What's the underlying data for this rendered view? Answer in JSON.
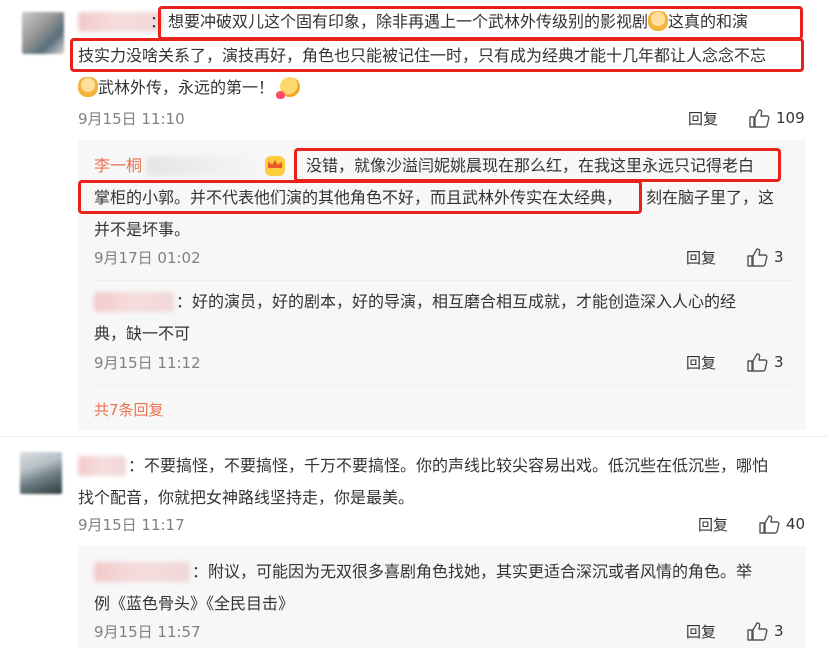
{
  "comments": [
    {
      "name_visible": "",
      "name_suffix": "：",
      "lines": [
        "想要冲破双儿这个固有印象，除非再遇上一个武林外传级别的影视剧",
        "这真的和演",
        "技实力没啥关系了，演技再好，角色也只能被记住一时，只有成为经典才能十几年都让人念念不忘",
        "武林外传，永远的第一！"
      ],
      "time": "9月15日 11:10",
      "reply_label": "回复",
      "like_count": "109"
    },
    {
      "name_visible": "",
      "name_suffix": "：",
      "lines": [
        "不要搞怪，不要搞怪，千万不要搞怪。你的声线比较尖容易出戏。低沉些在低沉些，哪怕",
        "找个配音，你就把女神路线坚持走，你是最美。"
      ],
      "time": "9月15日 11:17",
      "reply_label": "回复",
      "like_count": "40"
    }
  ],
  "replies": [
    {
      "name_visible": "李一桐",
      "lines": [
        "没错，就像沙溢闫妮姚晨现在那么红，在我这里永远只记得老白",
        "掌柜的小郭。并不代表他们演的其他角色不好，而且武林外传实在太经典，",
        "刻在脑子里了，这",
        "并不是坏事。"
      ],
      "time": "9月17日 01:02",
      "reply_label": "回复",
      "like_count": "3"
    },
    {
      "name_visible": "",
      "name_suffix": "：",
      "lines": [
        "好的演员，好的剧本，好的导演，相互磨合相互成就，才能创造深入人心的经",
        "典，缺一不可"
      ],
      "time": "9月15日 11:12",
      "reply_label": "回复",
      "like_count": "3"
    },
    {
      "name_visible": "",
      "name_suffix": "：",
      "lines": [
        "附议，可能因为无双很多喜剧角色找她，其实更适合深沉或者风情的角色。举",
        "例《蓝色骨头》《全民目击》"
      ],
      "time": "9月15日 11:57",
      "reply_label": "回复",
      "like_count": "3"
    }
  ],
  "more_replies": "共7条回复",
  "icons": [
    "thumbs-up-icon",
    "baby-emoji-icon",
    "kiss-emoji-icon",
    "crown-badge-icon"
  ],
  "colors": {
    "username": "#eb7350",
    "highlight_box": "#e8211b",
    "meta": "#808080",
    "subbox": "#f7f7f7"
  }
}
